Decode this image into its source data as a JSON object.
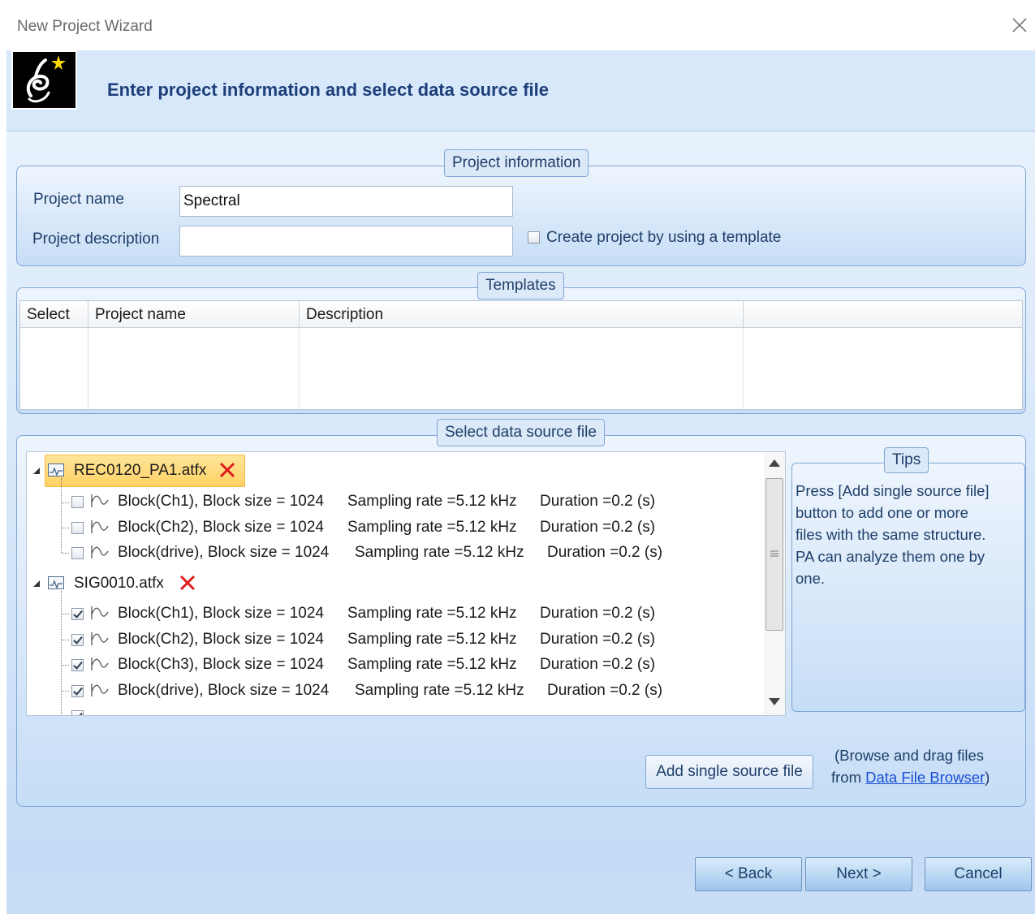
{
  "window": {
    "title": "New Project Wizard"
  },
  "header": {
    "heading": "Enter project information and select data source file"
  },
  "project_info": {
    "legend": "Project information",
    "name_label": "Project name",
    "name_value": "Spectral",
    "description_label": "Project description",
    "description_value": "",
    "template_checkbox_label": "Create project by using a template",
    "template_checked": false
  },
  "templates": {
    "legend": "Templates",
    "columns": [
      "Select",
      "Project name",
      "Description",
      ""
    ]
  },
  "data_source": {
    "legend": "Select data source file",
    "files": [
      {
        "name": "REC0120_PA1.atfx",
        "selected": true,
        "blocks": [
          {
            "checked": false,
            "block": "Block(Ch1), Block size = 1024",
            "rate": "Sampling rate =5.12 kHz",
            "duration": "Duration =0.2 (s)"
          },
          {
            "checked": false,
            "block": "Block(Ch2), Block size = 1024",
            "rate": "Sampling rate =5.12 kHz",
            "duration": "Duration =0.2 (s)"
          },
          {
            "checked": false,
            "block": "Block(drive), Block size = 1024",
            "rate": "Sampling rate =5.12 kHz",
            "duration": "Duration =0.2 (s)"
          }
        ]
      },
      {
        "name": "SIG0010.atfx",
        "selected": false,
        "blocks": [
          {
            "checked": true,
            "block": "Block(Ch1), Block size = 1024",
            "rate": "Sampling rate =5.12 kHz",
            "duration": "Duration =0.2 (s)"
          },
          {
            "checked": true,
            "block": "Block(Ch2), Block size = 1024",
            "rate": "Sampling rate =5.12 kHz",
            "duration": "Duration =0.2 (s)"
          },
          {
            "checked": true,
            "block": "Block(Ch3), Block size = 1024",
            "rate": "Sampling rate =5.12 kHz",
            "duration": "Duration =0.2 (s)"
          },
          {
            "checked": true,
            "block": "Block(drive), Block size = 1024",
            "rate": "Sampling rate =5.12 kHz",
            "duration": "Duration =0.2 (s)"
          }
        ]
      }
    ],
    "add_button": "Add single source file",
    "browse_hint_prefix": "(Browse and drag files",
    "browse_hint_from": "from ",
    "browse_link": "Data File Browser",
    "browse_hint_suffix": ")"
  },
  "tips": {
    "legend": "Tips",
    "lines": [
      "Press [Add single source file]",
      "button to add one or more",
      "files with the same structure.",
      "PA can analyze them one by",
      "one."
    ]
  },
  "footer": {
    "back": "< Back",
    "next": "Next >",
    "cancel": "Cancel"
  },
  "icons": {
    "close": "close-icon",
    "logo": "wizard-logo-icon",
    "file": "signal-file-icon",
    "wave": "waveform-icon",
    "remove": "remove-x-icon",
    "expand": "expanded-triangle-icon"
  },
  "colors": {
    "remove_x": "#e01b1b",
    "selection": "#ffd164",
    "heading": "#1e3f7a",
    "link": "#1a4fd6"
  }
}
